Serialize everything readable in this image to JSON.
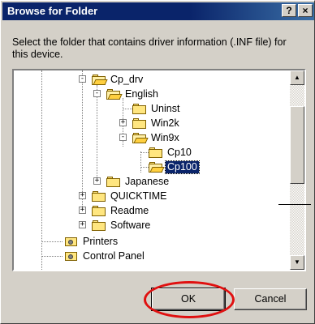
{
  "window": {
    "title": "Browse for Folder",
    "help_label": "?",
    "close_label": "×"
  },
  "instruction": "Select the folder that contains driver information (.INF file) for this device.",
  "tree": {
    "items": [
      {
        "label": "Cp_drv",
        "expander": "-",
        "icon": "open-folder"
      },
      {
        "label": "English",
        "expander": "-",
        "icon": "open-folder"
      },
      {
        "label": "Uninst",
        "expander": "",
        "icon": "folder"
      },
      {
        "label": "Win2k",
        "expander": "+",
        "icon": "folder"
      },
      {
        "label": "Win9x",
        "expander": "-",
        "icon": "open-folder"
      },
      {
        "label": "Cp10",
        "expander": "",
        "icon": "folder"
      },
      {
        "label": "Cp100",
        "expander": "",
        "icon": "open-folder",
        "selected": true
      },
      {
        "label": "Japanese",
        "expander": "+",
        "icon": "folder"
      },
      {
        "label": "QUICKTIME",
        "expander": "+",
        "icon": "folder"
      },
      {
        "label": "Readme",
        "expander": "+",
        "icon": "folder"
      },
      {
        "label": "Software",
        "expander": "+",
        "icon": "folder"
      },
      {
        "label": "Printers",
        "expander": "",
        "icon": "printers-folder"
      },
      {
        "label": "Control Panel",
        "expander": "",
        "icon": "control-panel-folder"
      }
    ]
  },
  "scrollbar": {
    "up_glyph": "▲",
    "down_glyph": "▼"
  },
  "buttons": {
    "ok": "OK",
    "cancel": "Cancel"
  },
  "colors": {
    "titlebar": "#0a246a",
    "dialog_face": "#d4d0c8",
    "selection": "#0a246a",
    "highlight_ring": "#e01010"
  }
}
